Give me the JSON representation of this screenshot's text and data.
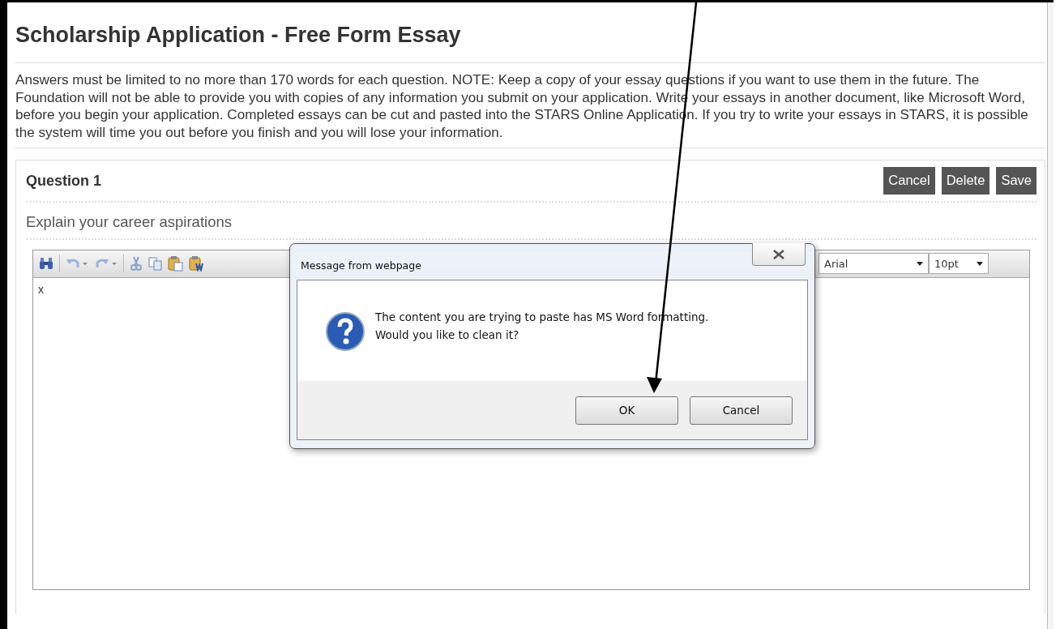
{
  "page": {
    "title": "Scholarship Application - Free Form Essay",
    "instructions": "Answers must be limited to no more than 170 words for each question. NOTE: Keep a copy of your essay questions if you want to use them in the future. The Foundation will not be able to provide you with copies of any information you submit on your application. Write your essays in another document, like Microsoft Word, before you begin your application. Completed essays can be cut and pasted into the STARS Online Application. If you try to write your essays in STARS, it is possible the system will time you out before you finish and you will lose your information."
  },
  "question": {
    "heading": "Question 1",
    "buttons": [
      "Cancel",
      "Delete",
      "Save"
    ],
    "prompt": "Explain your career aspirations"
  },
  "editor": {
    "font": "Arial",
    "size": "10pt",
    "content": "x"
  },
  "dialog": {
    "title": "Message from webpage",
    "message": [
      "The content you are trying to paste has MS Word formatting.",
      "Would you like to clean it?"
    ],
    "buttons": [
      "OK",
      "Cancel"
    ]
  }
}
